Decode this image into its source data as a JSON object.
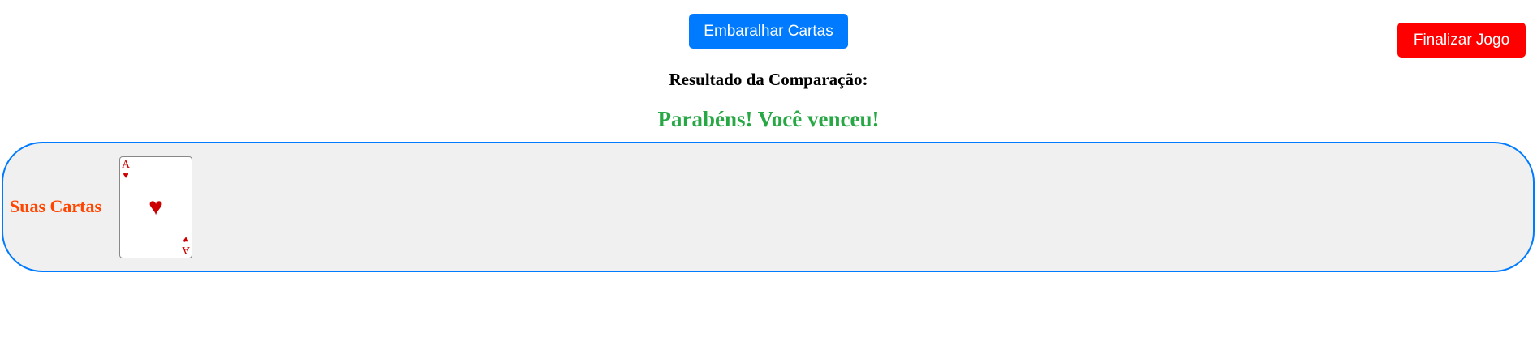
{
  "toolbar": {
    "shuffle_label": "Embaralhar Cartas",
    "end_game_label": "Finalizar Jogo"
  },
  "result": {
    "heading": "Resultado da Comparação:",
    "message": "Parabéns! Você venceu!"
  },
  "hand": {
    "label": "Suas Cartas",
    "cards": [
      {
        "rank": "A",
        "suit": "♥",
        "suit_name": "hearts-icon",
        "color": "#cc0000"
      }
    ]
  },
  "colors": {
    "shuffle_button": "#007bff",
    "end_game_button": "#ff0000",
    "win_message": "#28a745",
    "hand_label": "#ff4500",
    "hand_border": "#007bff",
    "hand_background": "#f0f0f0"
  }
}
